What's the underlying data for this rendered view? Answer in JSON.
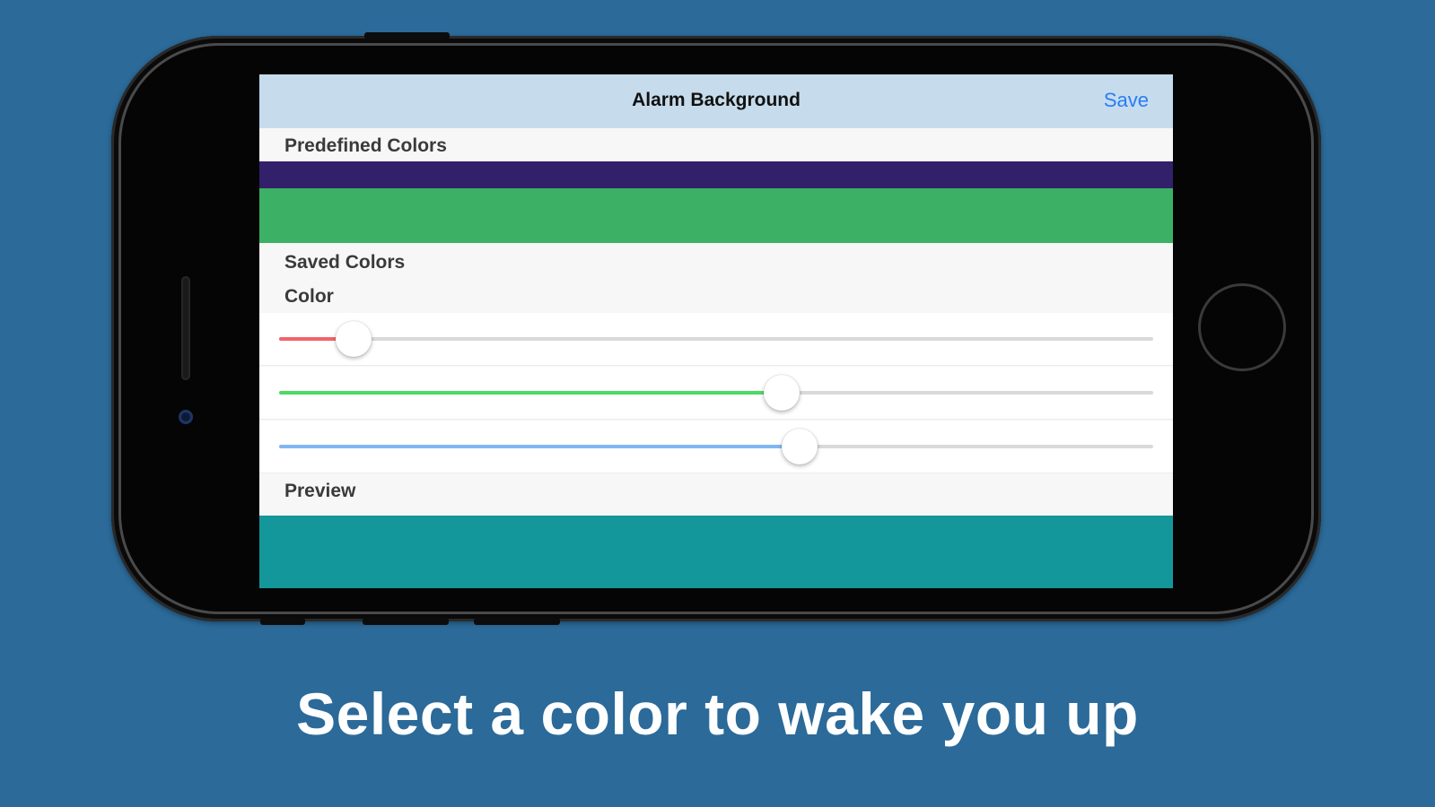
{
  "caption": "Select a color to wake you up",
  "screen": {
    "navbar": {
      "title": "Alarm Background",
      "save_label": "Save"
    },
    "predefined": {
      "header": "Predefined Colors",
      "swatches": [
        {
          "color": "#33206b"
        },
        {
          "color": "#3cb065"
        }
      ]
    },
    "saved_header": "Saved Colors",
    "color_header": "Color",
    "sliders": [
      {
        "channel": "red",
        "fill_color": "#f2636b",
        "value": 0.085
      },
      {
        "channel": "green",
        "fill_color": "#4cd964",
        "value": 0.575
      },
      {
        "channel": "blue",
        "fill_color": "#7fb7f5",
        "value": 0.595
      }
    ],
    "preview_header": "Preview",
    "preview_color": "#14979a"
  },
  "colors": {
    "background": "#2b6a99",
    "nav_bar": "#c6dcec",
    "accent": "#2a7cf5"
  }
}
